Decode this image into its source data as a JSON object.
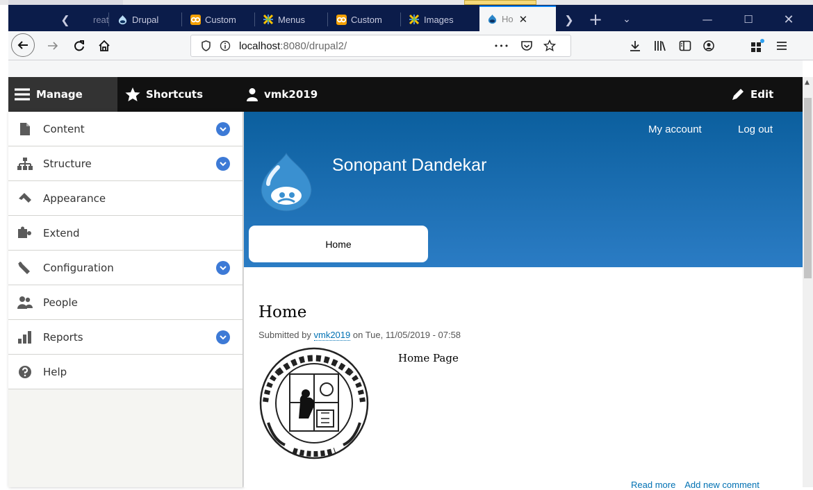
{
  "browser": {
    "tabs": [
      {
        "label": "reate",
        "icon": "page-icon"
      },
      {
        "label": "Drupal",
        "icon": "drupal-icon"
      },
      {
        "label": "Custom",
        "icon": "joomla-icon"
      },
      {
        "label": "Menus",
        "icon": "joomla-x-icon"
      },
      {
        "label": "Custom",
        "icon": "joomla-icon"
      },
      {
        "label": "Images",
        "icon": "joomla-x-icon"
      },
      {
        "label": "Ho",
        "icon": "drupal-icon",
        "active": true
      }
    ],
    "url_host": "localhost",
    "url_path": ":8080/drupal2/",
    "url_dots": "•••"
  },
  "toolbar": {
    "manage": "Manage",
    "shortcuts": "Shortcuts",
    "user": "vmk2019",
    "edit": "Edit"
  },
  "tray": {
    "items": [
      {
        "label": "Content",
        "icon": "content-icon",
        "expandable": true
      },
      {
        "label": "Structure",
        "icon": "structure-icon",
        "expandable": true
      },
      {
        "label": "Appearance",
        "icon": "appearance-icon",
        "expandable": false
      },
      {
        "label": "Extend",
        "icon": "extend-icon",
        "expandable": false
      },
      {
        "label": "Configuration",
        "icon": "wrench-icon",
        "expandable": true
      },
      {
        "label": "People",
        "icon": "people-icon",
        "expandable": false
      },
      {
        "label": "Reports",
        "icon": "reports-icon",
        "expandable": true
      },
      {
        "label": "Help",
        "icon": "help-icon",
        "expandable": false
      }
    ]
  },
  "site": {
    "my_account": "My account",
    "log_out": "Log out",
    "name": "Sonopant Dandekar",
    "nav_home": "Home"
  },
  "node": {
    "title": "Home",
    "submitted_prefix": "Submitted by",
    "author": "vmk2019",
    "submitted_suffix": "on Tue, 11/05/2019 - 07:58",
    "body": "Home Page",
    "read_more": "Read more",
    "add_comment": "Add new comment"
  },
  "colors": {
    "header_top": "#0b5f9e",
    "header_bottom": "#2b7cc4",
    "toolbar_bg": "#111111",
    "link": "#0071b3",
    "toggle": "#3d7ad6"
  }
}
